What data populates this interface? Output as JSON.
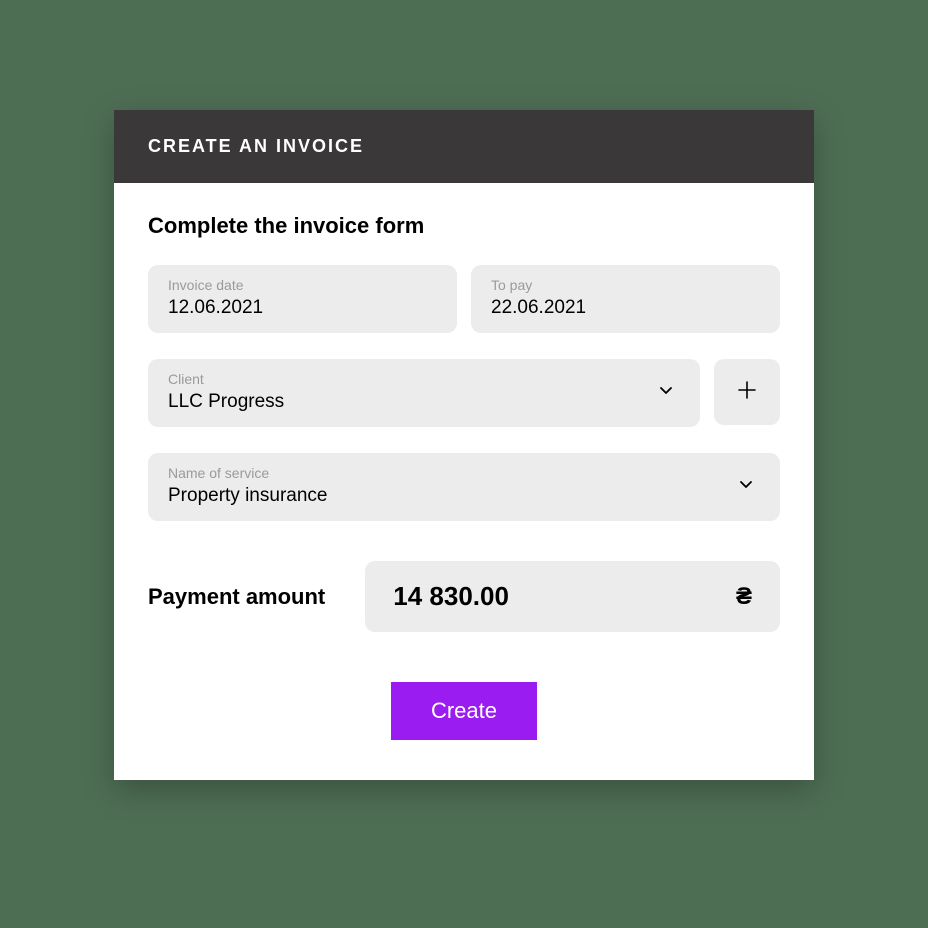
{
  "header": {
    "title": "CREATE AN INVOICE"
  },
  "form": {
    "subtitle": "Complete the invoice form",
    "invoice_date": {
      "label": "Invoice date",
      "value": "12.06.2021"
    },
    "to_pay": {
      "label": "To pay",
      "value": "22.06.2021"
    },
    "client": {
      "label": "Client",
      "value": "LLC Progress"
    },
    "service": {
      "label": "Name of service",
      "value": "Property insurance"
    },
    "amount": {
      "label": "Payment amount",
      "value": "14 830.00",
      "currency": "₴"
    },
    "create_label": "Create"
  }
}
